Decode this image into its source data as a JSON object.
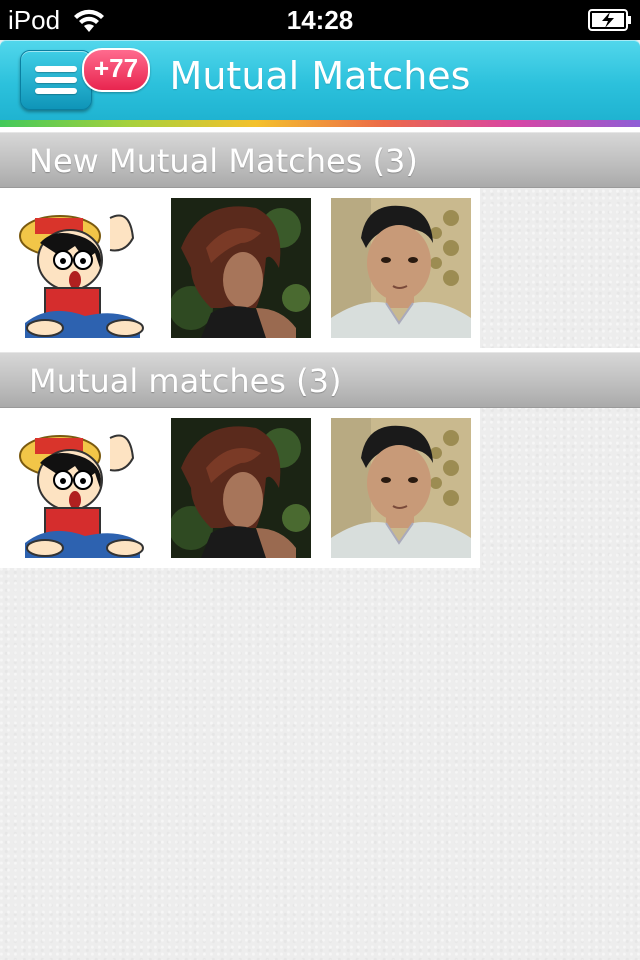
{
  "status_bar": {
    "carrier": "iPod",
    "time": "14:28"
  },
  "nav": {
    "title": "Mutual Matches",
    "badge": "+77",
    "menu_icon": "hamburger-menu-icon"
  },
  "sections": [
    {
      "title": "New Mutual Matches (3)",
      "photos": [
        "cartoon-avatar",
        "woman-photo",
        "man-photo"
      ]
    },
    {
      "title": "Mutual matches (3)",
      "photos": [
        "cartoon-avatar",
        "woman-photo",
        "man-photo"
      ]
    }
  ],
  "colors": {
    "nav_bg": "#2cc1dc",
    "badge_bg": "#e8254f",
    "section_header_bg": "#bdbdbd"
  }
}
